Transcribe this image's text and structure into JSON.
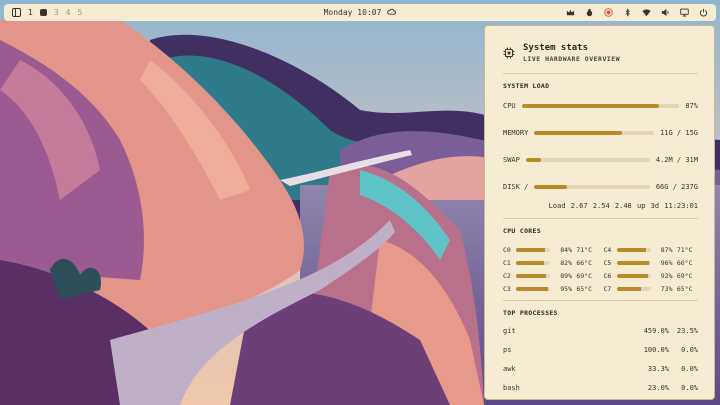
{
  "topbar": {
    "workspaces": [
      "1",
      "",
      "3",
      "4",
      "5"
    ],
    "active_workspace_index": 1,
    "clock": "Monday 10:07",
    "weather_icon": "cloud-icon",
    "tray_icons": [
      "crown-icon",
      "bug-icon",
      "record-icon",
      "bluetooth-icon",
      "wifi-icon",
      "volume-icon",
      "monitor-icon",
      "power-icon"
    ]
  },
  "panel": {
    "title": "System stats",
    "subtitle": "LIVE HARDWARE OVERVIEW",
    "system_load_title": "SYSTEM LOAD",
    "load": [
      {
        "label": "CPU",
        "value": "87%",
        "fraction": 0.87
      },
      {
        "label": "MEMORY",
        "value": "11G / 15G",
        "fraction": 0.73
      },
      {
        "label": "SWAP",
        "value": "4.2M / 31M",
        "fraction": 0.12
      },
      {
        "label": "DISK /",
        "value": "66G / 237G",
        "fraction": 0.28
      }
    ],
    "loadavg": {
      "label": "Load",
      "one": "2.67",
      "five": "2.54",
      "fifteen": "2.48",
      "uptime": "up 3d 11:23:01"
    },
    "cores_title": "CPU CORES",
    "cores": [
      {
        "name": "C0",
        "pct": "84%",
        "temp": "71°C",
        "fraction": 0.84
      },
      {
        "name": "C4",
        "pct": "87%",
        "temp": "71°C",
        "fraction": 0.87
      },
      {
        "name": "C1",
        "pct": "82%",
        "temp": "66°C",
        "fraction": 0.82
      },
      {
        "name": "C5",
        "pct": "96%",
        "temp": "66°C",
        "fraction": 0.96
      },
      {
        "name": "C2",
        "pct": "89%",
        "temp": "69°C",
        "fraction": 0.89
      },
      {
        "name": "C6",
        "pct": "92%",
        "temp": "69°C",
        "fraction": 0.92
      },
      {
        "name": "C3",
        "pct": "95%",
        "temp": "65°C",
        "fraction": 0.95
      },
      {
        "name": "C7",
        "pct": "73%",
        "temp": "65°C",
        "fraction": 0.73
      }
    ],
    "processes_title": "TOP PROCESSES",
    "processes": [
      {
        "name": "git",
        "cpu": "459.0%",
        "mem": "23.5%"
      },
      {
        "name": "ps",
        "cpu": "100.0%",
        "mem": "0.0%"
      },
      {
        "name": "awk",
        "cpu": "33.3%",
        "mem": "0.0%"
      },
      {
        "name": "bash",
        "cpu": "23.0%",
        "mem": "0.0%"
      }
    ]
  },
  "colors": {
    "accent": "#b98a2a",
    "panel_bg": "#f6ecd3",
    "record": "#d8553a"
  }
}
